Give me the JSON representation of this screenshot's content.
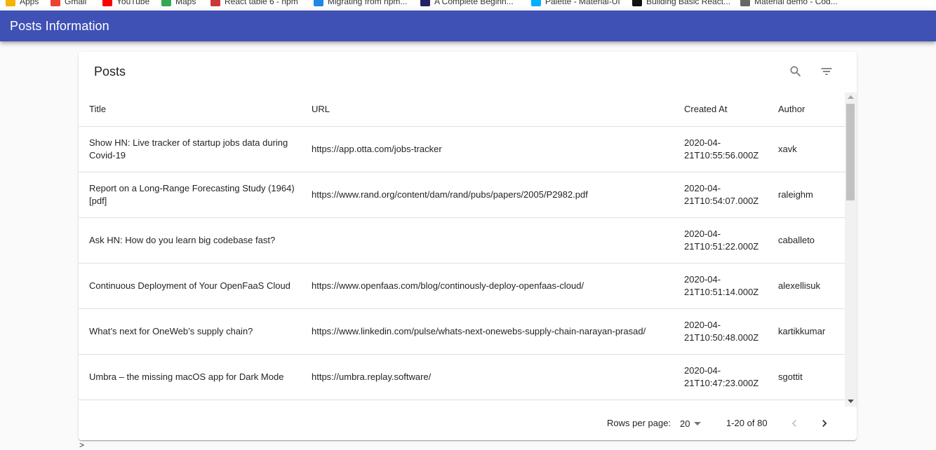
{
  "bookmarks": [
    {
      "label": "Apps",
      "color": "#f4b400"
    },
    {
      "label": "Gmail",
      "color": "#ea4335"
    },
    {
      "label": "YouTube",
      "color": "#ff0000"
    },
    {
      "label": "Maps",
      "color": "#34a853"
    },
    {
      "label": "React table 6 - npm",
      "color": "#cb3837"
    },
    {
      "label": "Migrating from npm...",
      "color": "#1e88e5"
    },
    {
      "label": "A Complete Beginn...",
      "color": "#222266"
    },
    {
      "label": "Palette - Material-UI",
      "color": "#00b0ff"
    },
    {
      "label": "Building Basic React...",
      "color": "#111111"
    },
    {
      "label": "Material demo - Cod...",
      "color": "#666666"
    }
  ],
  "appbar": {
    "title": "Posts Information",
    "color": "#3f51b5"
  },
  "table": {
    "title": "Posts",
    "toolbar_icons": [
      "search-icon",
      "filter-list-icon"
    ],
    "columns": [
      "Title",
      "URL",
      "Created At",
      "Author"
    ],
    "rows": [
      {
        "title": "Show HN: Live tracker of startup jobs data during Covid-19",
        "url": "https://app.otta.com/jobs-tracker",
        "created_at": "2020-04-21T10:55:56.000Z",
        "author": "xavk"
      },
      {
        "title": "Report on a Long-Range Forecasting Study (1964) [pdf]",
        "url": "https://www.rand.org/content/dam/rand/pubs/papers/2005/P2982.pdf",
        "created_at": "2020-04-21T10:54:07.000Z",
        "author": "raleighm"
      },
      {
        "title": "Ask HN: How do you learn big codebase fast?",
        "url": "",
        "created_at": "2020-04-21T10:51:22.000Z",
        "author": "caballeto"
      },
      {
        "title": "Continuous Deployment of Your OpenFaaS Cloud",
        "url": "https://www.openfaas.com/blog/continously-deploy-openfaas-cloud/",
        "created_at": "2020-04-21T10:51:14.000Z",
        "author": "alexellisuk"
      },
      {
        "title": "What’s next for OneWeb’s supply chain?",
        "url": "https://www.linkedin.com/pulse/whats-next-onewebs-supply-chain-narayan-prasad/",
        "created_at": "2020-04-21T10:50:48.000Z",
        "author": "kartikkumar"
      },
      {
        "title": "Umbra – the missing macOS app for Dark Mode",
        "url": "https://umbra.replay.software/",
        "created_at": "2020-04-21T10:47:23.000Z",
        "author": "sgottit"
      }
    ]
  },
  "pagination": {
    "rows_per_page_label": "Rows per page:",
    "rows_per_page": "20",
    "range": "1-20 of 80"
  },
  "footer_text": ">"
}
